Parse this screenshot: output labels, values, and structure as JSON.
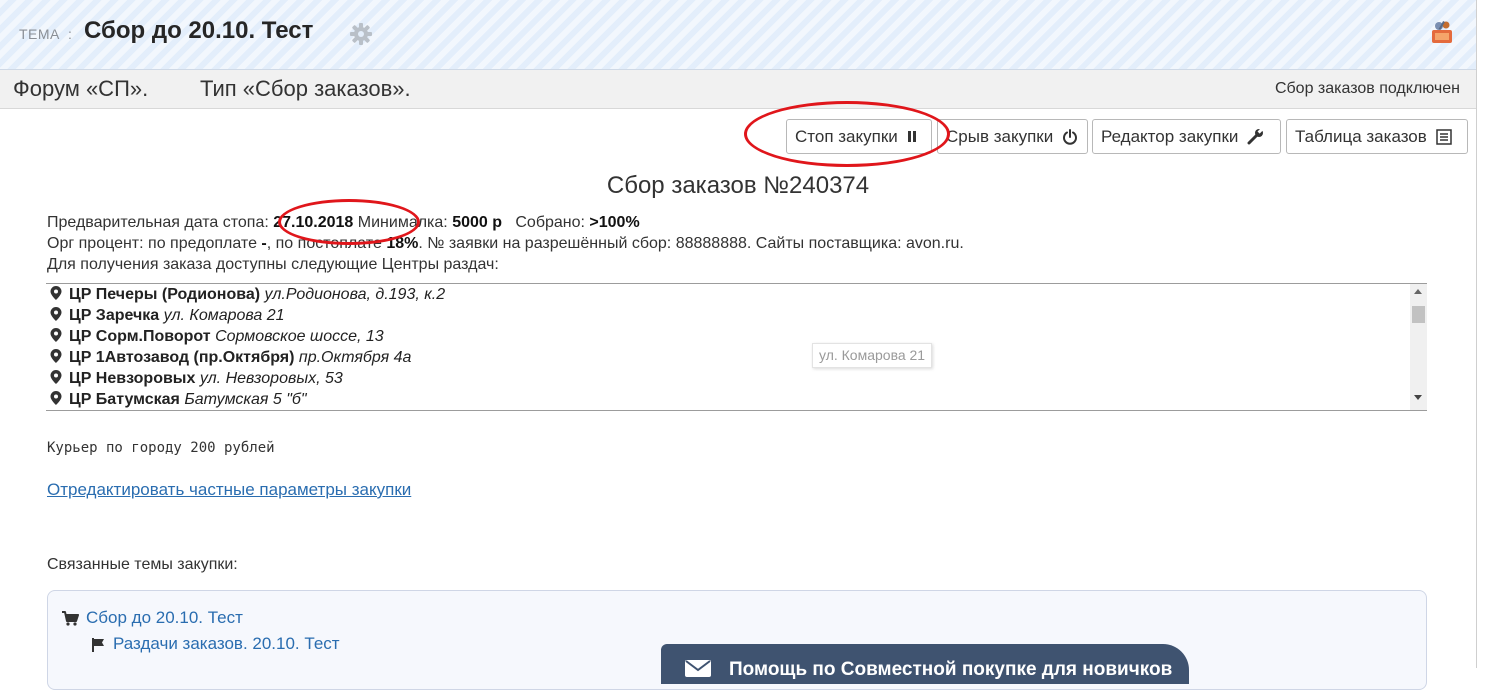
{
  "header": {
    "prefix": "ТЕМА",
    "separator": ":",
    "title": "Сбор до 20.10. Тест"
  },
  "forum_bar": {
    "forum": "Форум «СП».",
    "type": "Тип «Сбор заказов».",
    "status": "Сбор заказов подключен"
  },
  "buttons": {
    "stop": "Стоп закупки",
    "fail": "Срыв закупки",
    "editor": "Редактор закупки",
    "table": "Таблица заказов"
  },
  "order": {
    "title": "Сбор заказов №240374",
    "stop_date_label": "Предварительная дата стопа:",
    "stop_date": "27.10.2018",
    "min_label": "Минималка:",
    "min_value": "5000 р",
    "collected_label": "Собрано:",
    "collected_value": ">100%",
    "org_label": "Орг процент: по предоплате",
    "org_prepay": "-",
    "org_postpay_label": ", по постоплате",
    "org_postpay": "18%",
    "application_label": ". № заявки на разрешённый сбор:",
    "application_no": "88888888",
    "sites_label": ". Сайты поставщика:",
    "sites": "avon.ru.",
    "centers_intro": "Для получения заказа доступны следующие Центры раздач:"
  },
  "centers": [
    {
      "name": "ЦР Печеры (Родионова)",
      "address": "ул.Родионова, д.193, к.2"
    },
    {
      "name": "ЦР Заречка",
      "address": "ул. Комарова 21"
    },
    {
      "name": "ЦР Сорм.Поворот",
      "address": "Сормовское шоссе, 13"
    },
    {
      "name": "ЦР 1Автозавод (пр.Октября)",
      "address": "пр.Октября 4а"
    },
    {
      "name": "ЦР Невзоровых",
      "address": "ул. Невзоровых, 53"
    },
    {
      "name": "ЦР Батумская",
      "address": "Батумская 5 \"б\""
    }
  ],
  "tooltip": "ул. Комарова 21",
  "courier": "Курьер по городу 200 рублей",
  "edit_link": "Отредактировать частные параметры закупки",
  "related": {
    "label": "Связанные темы закупки:",
    "items": [
      "Сбор до 20.10. Тест",
      "Раздачи заказов. 20.10. Тест"
    ]
  },
  "help_tab": "Помощь по Совместной покупке для новичков",
  "colors": {
    "accent_link": "#2a6db0",
    "annotation_red": "#e0161b",
    "help_tab_bg": "#3f5370",
    "header_bg": "#e3eefb"
  },
  "icons": [
    "gear-icon",
    "user-icon",
    "pause-icon",
    "power-icon",
    "wrench-icon",
    "list-icon",
    "map-pin-icon",
    "cart-icon",
    "flag-icon",
    "mail-icon"
  ]
}
